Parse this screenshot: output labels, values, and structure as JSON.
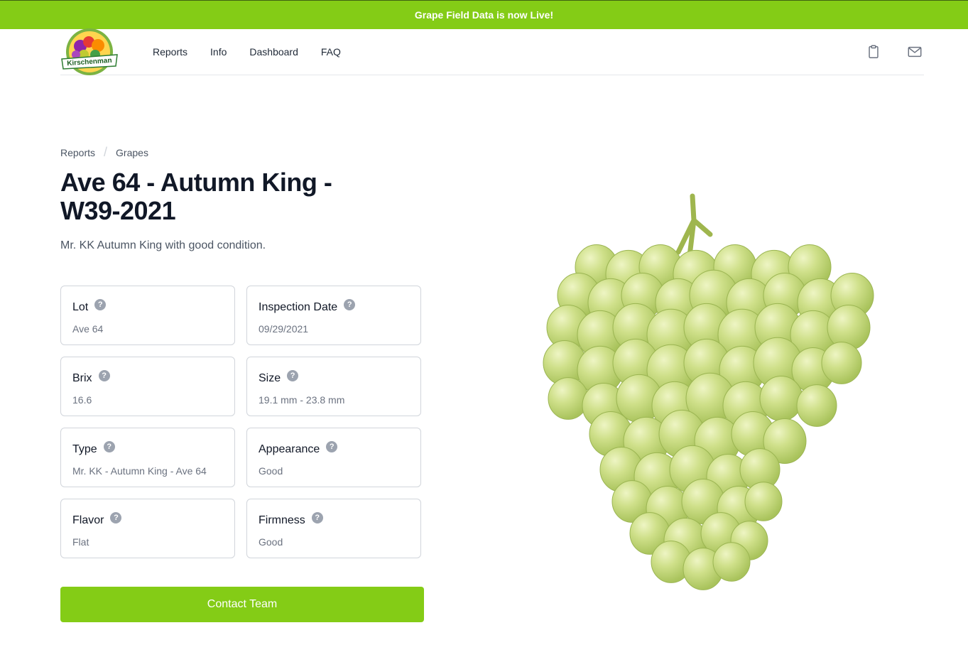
{
  "banner": {
    "text": "Grape Field Data is now Live!"
  },
  "logo": {
    "alt": "Kirschenman logo",
    "text": "Kirschenman"
  },
  "nav": {
    "links": [
      "Reports",
      "Info",
      "Dashboard",
      "FAQ"
    ],
    "icons": [
      "clipboard-icon",
      "mail-icon"
    ]
  },
  "breadcrumb": [
    "Reports",
    "Grapes"
  ],
  "report": {
    "title": "Ave 64 - Autumn King - W39-2021",
    "description": "Mr. KK Autumn King with good condition."
  },
  "details": [
    {
      "label": "Lot",
      "value": "Ave 64"
    },
    {
      "label": "Inspection Date",
      "value": "09/29/2021"
    },
    {
      "label": "Brix",
      "value": "16.6"
    },
    {
      "label": "Size",
      "value": "19.1 mm - 23.8 mm"
    },
    {
      "label": "Type",
      "value": "Mr. KK - Autumn King - Ave 64"
    },
    {
      "label": "Appearance",
      "value": "Good"
    },
    {
      "label": "Flavor",
      "value": "Flat"
    },
    {
      "label": "Firmness",
      "value": "Good"
    }
  ],
  "help_glyph": "?",
  "cta": {
    "label": "Contact Team"
  },
  "image": {
    "alt": "green grape bunch"
  },
  "colors": {
    "accent": "#84cc16",
    "text": "#111827",
    "muted": "#6b7280",
    "border": "#d1d5db"
  }
}
